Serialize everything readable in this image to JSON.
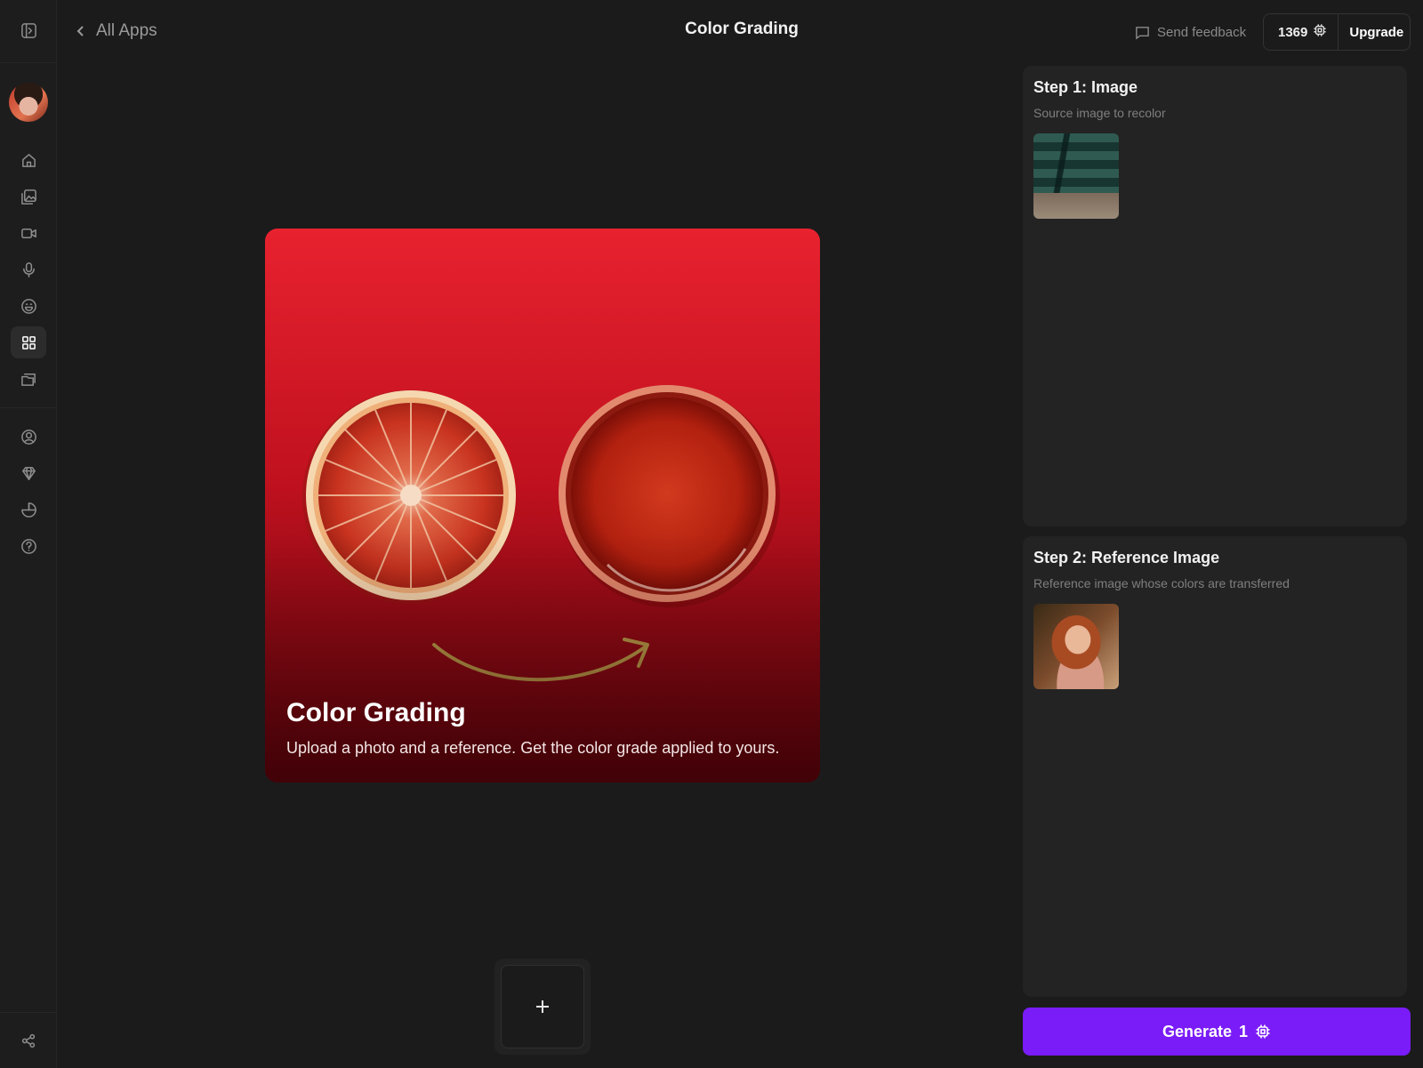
{
  "header": {
    "back_label": "All Apps",
    "title": "Color Grading",
    "feedback_label": "Send feedback",
    "credits": "1369",
    "upgrade_label": "Upgrade"
  },
  "sidebar": {
    "items": [
      {
        "name": "home",
        "icon": "home-icon"
      },
      {
        "name": "images",
        "icon": "images-icon"
      },
      {
        "name": "video",
        "icon": "video-icon"
      },
      {
        "name": "audio",
        "icon": "microphone-icon"
      },
      {
        "name": "avatars",
        "icon": "smile-icon"
      },
      {
        "name": "apps",
        "icon": "grid-icon",
        "active": true
      },
      {
        "name": "files",
        "icon": "folder-icon"
      },
      {
        "name": "profile",
        "icon": "user-circle-icon"
      },
      {
        "name": "plans",
        "icon": "diamond-icon"
      },
      {
        "name": "usage",
        "icon": "pie-chart-icon"
      },
      {
        "name": "help",
        "icon": "help-icon"
      },
      {
        "name": "share",
        "icon": "share-icon"
      }
    ]
  },
  "hero": {
    "title": "Color Grading",
    "description": "Upload a photo and a reference. Get the color grade applied to yours."
  },
  "steps": [
    {
      "title": "Step 1: Image",
      "subtitle": "Source image to recolor"
    },
    {
      "title": "Step 2: Reference Image",
      "subtitle": "Reference image whose colors are transferred"
    }
  ],
  "generate": {
    "label": "Generate",
    "cost": "1"
  },
  "colors": {
    "accent": "#7a1cf7",
    "background": "#1b1b1b",
    "panel": "#232323",
    "hero_red": "#e8222f"
  }
}
